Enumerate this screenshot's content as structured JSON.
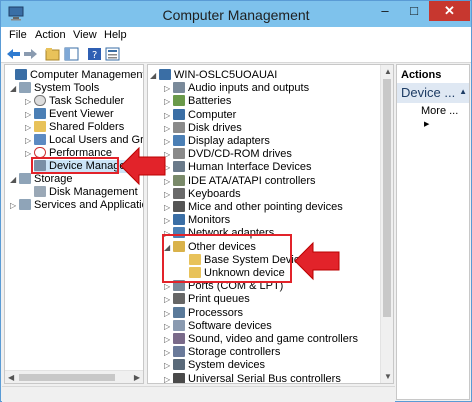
{
  "window": {
    "title": "Computer Management",
    "min_glyph": "–",
    "max_glyph": "□",
    "close_glyph": "✕"
  },
  "menu": [
    "File",
    "Action",
    "View",
    "Help"
  ],
  "toolbar_icons": [
    "back-arrow-icon",
    "forward-arrow-icon",
    "up-folder-icon",
    "show-tree-icon",
    "help-icon",
    "properties-icon"
  ],
  "left_tree": [
    {
      "label": "Computer Management (Loca",
      "expander": ""
    },
    {
      "label": "System Tools",
      "expander": "◢"
    },
    {
      "label": "Task Scheduler",
      "expander": "▷"
    },
    {
      "label": "Event Viewer",
      "expander": "▷"
    },
    {
      "label": "Shared Folders",
      "expander": "▷"
    },
    {
      "label": "Local Users and Groups",
      "expander": "▷"
    },
    {
      "label": "Performance",
      "expander": "▷"
    },
    {
      "label": "Device Manager",
      "expander": ""
    },
    {
      "label": "Storage",
      "expander": "◢"
    },
    {
      "label": "Disk Management",
      "expander": ""
    },
    {
      "label": "Services and Applications",
      "expander": "▷"
    }
  ],
  "device_tree": [
    {
      "label": "WIN-OSLC5UOAUAI",
      "expander": "◢"
    },
    {
      "label": "Audio inputs and outputs",
      "expander": "▷"
    },
    {
      "label": "Batteries",
      "expander": "▷"
    },
    {
      "label": "Computer",
      "expander": "▷"
    },
    {
      "label": "Disk drives",
      "expander": "▷"
    },
    {
      "label": "Display adapters",
      "expander": "▷"
    },
    {
      "label": "DVD/CD-ROM drives",
      "expander": "▷"
    },
    {
      "label": "Human Interface Devices",
      "expander": "▷"
    },
    {
      "label": "IDE ATA/ATAPI controllers",
      "expander": "▷"
    },
    {
      "label": "Keyboards",
      "expander": "▷"
    },
    {
      "label": "Mice and other pointing devices",
      "expander": "▷"
    },
    {
      "label": "Monitors",
      "expander": "▷"
    },
    {
      "label": "Network adapters",
      "expander": "▷"
    },
    {
      "label": "Other devices",
      "expander": "◢"
    },
    {
      "label": "Base System Device",
      "expander": ""
    },
    {
      "label": "Unknown device",
      "expander": ""
    },
    {
      "label": "Ports (COM & LPT)",
      "expander": "▷"
    },
    {
      "label": "Print queues",
      "expander": "▷"
    },
    {
      "label": "Processors",
      "expander": "▷"
    },
    {
      "label": "Software devices",
      "expander": "▷"
    },
    {
      "label": "Sound, video and game controllers",
      "expander": "▷"
    },
    {
      "label": "Storage controllers",
      "expander": "▷"
    },
    {
      "label": "System devices",
      "expander": "▷"
    },
    {
      "label": "Universal Serial Bus controllers",
      "expander": "▷"
    }
  ],
  "actions": {
    "header": "Actions",
    "sub": "Device ...",
    "sub_glyph": "▲",
    "more": "More ...",
    "more_glyph": "▶"
  },
  "colors": {
    "accent_red": "#e2232a",
    "titlebar": "#7ec2ec",
    "close": "#c7372f"
  }
}
